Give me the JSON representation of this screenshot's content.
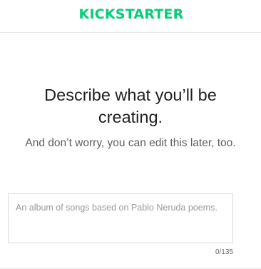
{
  "header": {
    "logo_text": "KICKSTARTER",
    "brand_color": "#05ce78"
  },
  "main": {
    "title": "Describe what you’ll be creating.",
    "subtitle": "And don’t worry, you can edit this later, too.",
    "description_input": {
      "value": "",
      "placeholder": "An album of songs based on Pablo Neruda poems."
    },
    "char_counter": "0/135"
  }
}
